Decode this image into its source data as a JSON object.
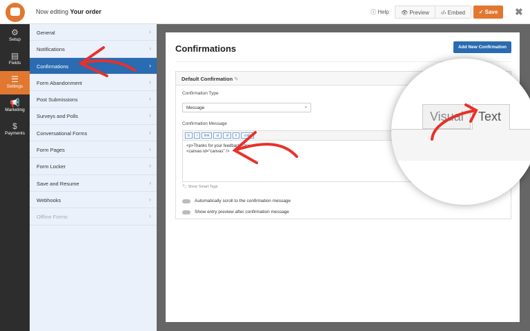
{
  "header": {
    "editing_prefix": "Now editing",
    "form_name": "Your order",
    "help": "Help",
    "preview": "Preview",
    "embed": "Embed",
    "save": "Save",
    "close_icon": "close-icon"
  },
  "rail": [
    {
      "label": "Setup",
      "icon": "gear-icon"
    },
    {
      "label": "Fields",
      "icon": "fields-icon"
    },
    {
      "label": "Settings",
      "icon": "sliders-icon"
    },
    {
      "label": "Marketing",
      "icon": "megaphone-icon"
    },
    {
      "label": "Payments",
      "icon": "dollar-icon"
    }
  ],
  "submenu": [
    "General",
    "Notifications",
    "Confirmations",
    "Form Abandonment",
    "Post Submissions",
    "Surveys and Polls",
    "Conversational Forms",
    "Form Pages",
    "Form Locker",
    "Save and Resume",
    "Webhooks",
    "Offline Forms"
  ],
  "main": {
    "title": "Confirmations",
    "add_button": "Add New Confirmation",
    "card_title": "Default Confirmation",
    "type_label": "Confirmation Type",
    "type_value": "Message",
    "message_label": "Confirmation Message",
    "toolbar": [
      "b",
      "i",
      "link",
      "ul",
      "ol",
      "li",
      "code"
    ],
    "code_line1": "<p>Thanks for your feedback!</p>",
    "code_line2": "<canvas id=\"canvas\" />",
    "smart_tags": "Show Smart Tags",
    "toggle1": "Automatically scroll to the confirmation message",
    "toggle2": "Show entry preview after confirmation message"
  },
  "magnifier": {
    "visual_tab": "Visual",
    "text_tab": "Text"
  },
  "colors": {
    "accent": "#e27730",
    "blue": "#2a6bb1",
    "arrow": "#e8312a"
  }
}
